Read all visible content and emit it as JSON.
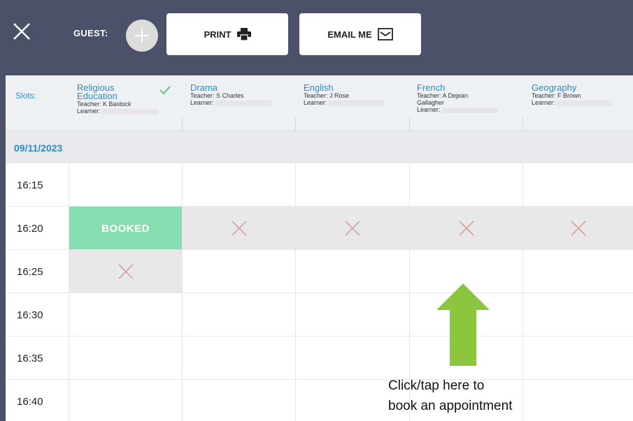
{
  "toolbar": {
    "guest_label": "GUEST:",
    "print_label": "PRINT",
    "email_label": "EMAIL ME"
  },
  "slots_label": "Slots:",
  "subjects": [
    {
      "name_line1": "Religious",
      "name_line2": "Education",
      "teacher": "Teacher: K Bastock",
      "learner": "Learner:",
      "selected": true
    },
    {
      "name_line1": "Drama",
      "name_line2": "",
      "teacher": "Teacher: S Charles",
      "learner": "Learner:",
      "selected": false
    },
    {
      "name_line1": "English",
      "name_line2": "",
      "teacher": "Teacher: J Rose",
      "learner": "Learner:",
      "selected": false
    },
    {
      "name_line1": "French",
      "name_line2": "",
      "teacher": "Teacher: A Dejean",
      "teacher_line2": "Gallagher",
      "learner": "Learner:",
      "selected": false
    },
    {
      "name_line1": "Geography",
      "name_line2": "",
      "teacher": "Teacher: F Brown",
      "learner": "Learner:",
      "selected": false
    }
  ],
  "date": "09/11/2023",
  "rows": [
    {
      "time": "16:15",
      "cells": [
        "free",
        "free",
        "free",
        "free",
        "free"
      ]
    },
    {
      "time": "16:20",
      "cells": [
        "booked",
        "unavailable",
        "unavailable",
        "unavailable",
        "unavailable"
      ]
    },
    {
      "time": "16:25",
      "cells": [
        "unavailable",
        "free",
        "free",
        "free",
        "free"
      ]
    },
    {
      "time": "16:30",
      "cells": [
        "free",
        "free",
        "free",
        "free",
        "free"
      ]
    },
    {
      "time": "16:35",
      "cells": [
        "free",
        "free",
        "free",
        "free",
        "free"
      ]
    },
    {
      "time": "16:40",
      "cells": [
        "free",
        "free",
        "free",
        "free",
        "free"
      ]
    }
  ],
  "booked_label": "BOOKED",
  "callout": {
    "line1": "Click/tap here to",
    "line2": "book an appointment"
  },
  "colors": {
    "topbar": "#4a5168",
    "accent": "#2b8ccb",
    "booked": "#86ddb0",
    "arrow": "#8cc63f",
    "xmark": "#d9a0a0"
  },
  "icons": {
    "close": "close-icon",
    "add": "plus-icon",
    "print": "printer-icon",
    "email": "envelope-icon",
    "check": "check-icon",
    "arrow": "arrow-up-icon",
    "unavailable": "x-icon"
  }
}
